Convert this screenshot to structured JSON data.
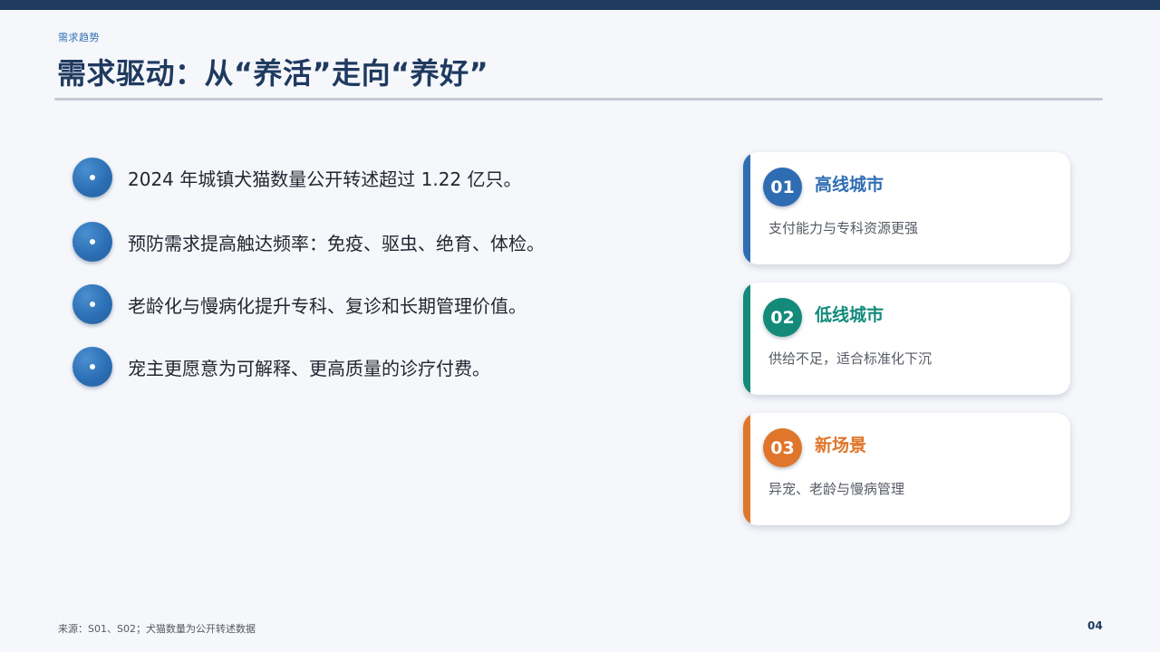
{
  "header": {
    "section_tag": "需求趋势",
    "title": "需求驱动：从“养活”走向“养好”"
  },
  "bullets": [
    {
      "text": "2024 年城镇犬猫数量公开转述超过 1.22 亿只。"
    },
    {
      "text": "预防需求提高触达频率：免疫、驱虫、绝育、体检。"
    },
    {
      "text": "老龄化与慢病化提升专科、复诊和长期管理价值。"
    },
    {
      "text": "宠主更愿意为可解释、更高质量的诊疗付费。"
    }
  ],
  "cards": [
    {
      "number": "01",
      "title": "高线城市",
      "desc": "支付能力与专科资源更强",
      "color": "#2f6db3"
    },
    {
      "number": "02",
      "title": "低线城市",
      "desc": "供给不足，适合标准化下沉",
      "color": "#138a7a"
    },
    {
      "number": "03",
      "title": "新场景",
      "desc": "异宠、老龄与慢病管理",
      "color": "#e0762b"
    }
  ],
  "footer": {
    "source": "来源：S01、S02；犬猫数量为公开转述数据",
    "page_number": "04"
  },
  "colors": {
    "top_bar": "#1f3a5f",
    "bullet_blue": "#2c6fb5"
  }
}
